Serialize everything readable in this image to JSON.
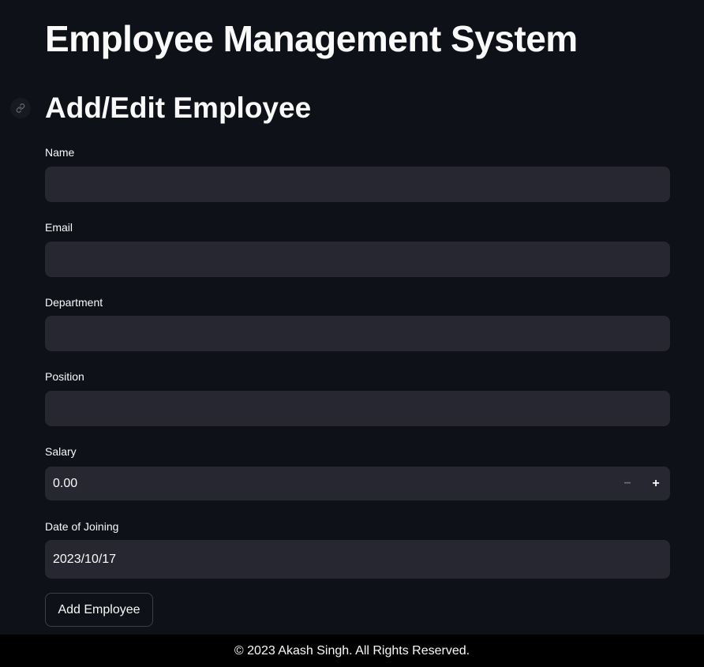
{
  "header": {
    "title": "Employee Management System"
  },
  "section": {
    "title": "Add/Edit Employee"
  },
  "form": {
    "name": {
      "label": "Name",
      "value": ""
    },
    "email": {
      "label": "Email",
      "value": ""
    },
    "department": {
      "label": "Department",
      "value": ""
    },
    "position": {
      "label": "Position",
      "value": ""
    },
    "salary": {
      "label": "Salary",
      "value": "0.00",
      "minus": "−",
      "plus": "+"
    },
    "date_of_joining": {
      "label": "Date of Joining",
      "value": "2023/10/17"
    },
    "submit_label": "Add Employee"
  },
  "footer": {
    "text": "© 2023 Akash Singh. All Rights Reserved."
  },
  "icons": {
    "anchor": "link-icon"
  },
  "colors": {
    "background": "#0e1117",
    "input_bg": "#262730",
    "text": "#fafafa",
    "footer_bg": "#000000"
  }
}
